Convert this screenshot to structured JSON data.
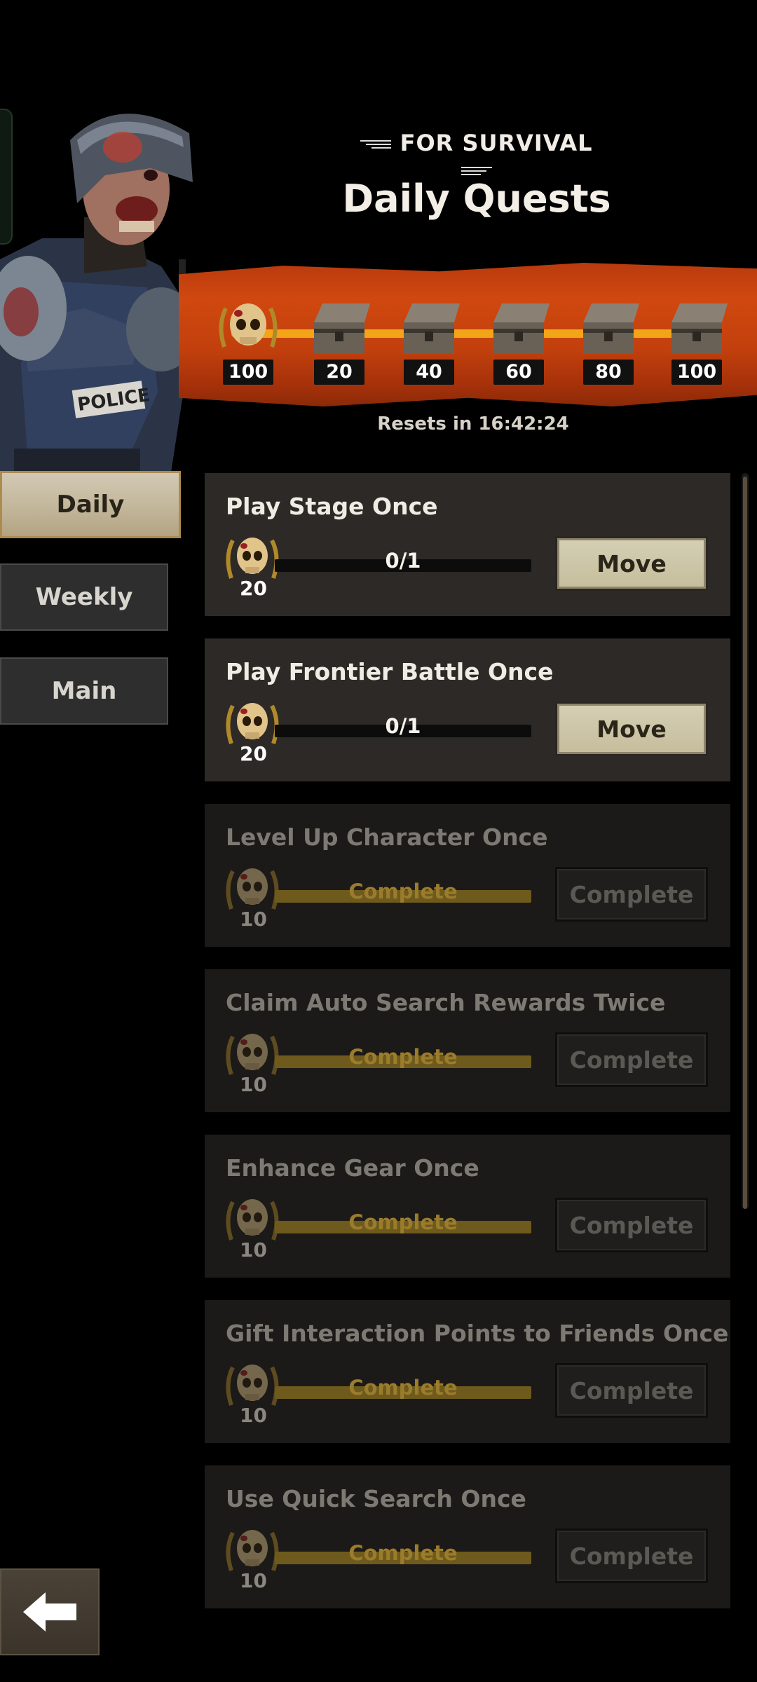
{
  "header": {
    "subtitle": "FOR SURVIVAL",
    "title": "Daily Quests"
  },
  "progress_rewards": {
    "points_icon_value": "100",
    "milestones": [
      "20",
      "40",
      "60",
      "80",
      "100"
    ],
    "resets_text": "Resets in 16:42:24",
    "bar_color": "#f2a516",
    "banner_color": "#c2400d"
  },
  "tabs": [
    {
      "label": "Daily",
      "active": true
    },
    {
      "label": "Weekly",
      "active": false
    },
    {
      "label": "Main",
      "active": false
    }
  ],
  "quests": [
    {
      "title": "Play Stage Once",
      "reward": "20",
      "progress": "0/1",
      "button": "Move",
      "completed": false
    },
    {
      "title": "Play Frontier Battle Once",
      "reward": "20",
      "progress": "0/1",
      "button": "Move",
      "completed": false
    },
    {
      "title": "Level Up Character Once",
      "reward": "10",
      "progress": "Complete",
      "button": "Complete",
      "completed": true
    },
    {
      "title": "Claim Auto Search Rewards Twice",
      "reward": "10",
      "progress": "Complete",
      "button": "Complete",
      "completed": true
    },
    {
      "title": "Enhance Gear Once",
      "reward": "10",
      "progress": "Complete",
      "button": "Complete",
      "completed": true
    },
    {
      "title": "Gift Interaction Points to Friends Once",
      "reward": "10",
      "progress": "Complete",
      "button": "Complete",
      "completed": true
    },
    {
      "title": "Use Quick Search Once",
      "reward": "10",
      "progress": "Complete",
      "button": "Complete",
      "completed": true
    }
  ],
  "icons": {
    "back": "back-arrow-icon",
    "skull": "skull-laurel-icon",
    "chest": "treasure-chest-icon",
    "character": "zombie-police-character"
  }
}
